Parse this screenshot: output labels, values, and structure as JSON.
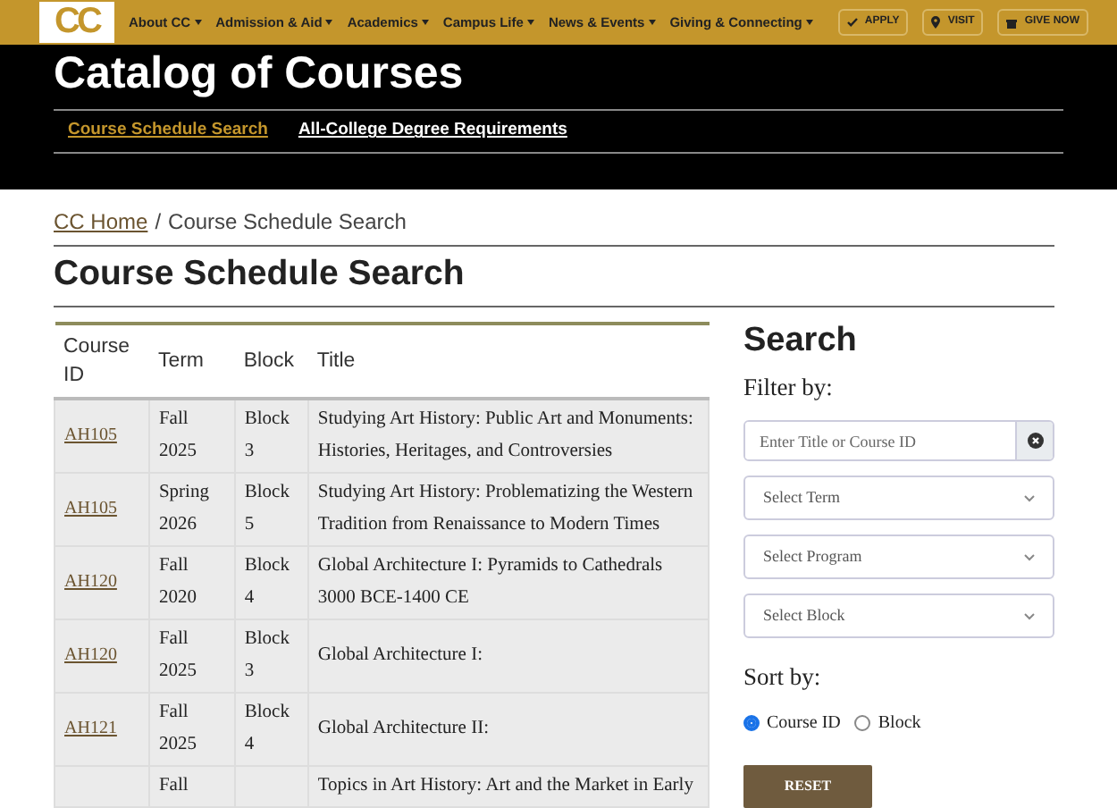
{
  "logo": {
    "text": "CC"
  },
  "nav_menu": [
    {
      "label": "About CC"
    },
    {
      "label": "Admission & Aid"
    },
    {
      "label": "Academics"
    },
    {
      "label": "Campus Life"
    },
    {
      "label": "News & Events"
    },
    {
      "label": "Giving & Connecting"
    }
  ],
  "nav_buttons": [
    {
      "label": "APPLY",
      "kind": "check"
    },
    {
      "label": "VISIT",
      "kind": "pin"
    },
    {
      "label": "GIVE NOW",
      "kind": "gift"
    }
  ],
  "hero": {
    "title": "Catalog of Courses",
    "tabs": [
      {
        "label": "Course Schedule Search",
        "selected": true
      },
      {
        "label": "All-College Degree Requirements",
        "selected": false
      }
    ]
  },
  "breadcrumb": [
    {
      "label": "CC Home",
      "link": true
    },
    {
      "label": "Course Schedule Search",
      "link": false
    }
  ],
  "breadcrumb_separator": "/",
  "page_title": "Course Schedule Search",
  "table": {
    "columns": [
      "Course ID",
      "Term",
      "Block",
      "Title"
    ],
    "rows": [
      {
        "course_id": "AH105",
        "term": "Fall 2025",
        "block": "Block 3",
        "title": "Studying Art History: Public Art and Monuments: Histories, Heritages, and Controversies"
      },
      {
        "course_id": "AH105",
        "term": "Spring 2026",
        "block": "Block 5",
        "title": "Studying Art History: Problematizing the Western Tradition from Renaissance to Modern Times"
      },
      {
        "course_id": "AH120",
        "term": "Fall 2020",
        "block": "Block 4",
        "title": "Global Architecture I: Pyramids to Cathedrals 3000 BCE-1400 CE"
      },
      {
        "course_id": "AH120",
        "term": "Fall 2025",
        "block": "Block 3",
        "title": "Global Architecture I:"
      },
      {
        "course_id": "AH121",
        "term": "Fall 2025",
        "block": "Block 4",
        "title": "Global Architecture II:"
      },
      {
        "course_id": "",
        "term": "Fall",
        "block": "",
        "title": "Topics in Art History: Art and the Market in Early"
      }
    ]
  },
  "search": {
    "title": "Search",
    "filter_label": "Filter by:",
    "text_field": {
      "placeholder": "Enter Title or Course ID"
    },
    "selects": [
      {
        "placeholder": "Select Term"
      },
      {
        "placeholder": "Select Program"
      },
      {
        "placeholder": "Select Block"
      }
    ],
    "sort_label": "Sort by:",
    "sort_options": [
      {
        "label": "Course ID",
        "selected": true
      },
      {
        "label": "Block",
        "selected": false
      }
    ],
    "reset_button": "RESET"
  }
}
